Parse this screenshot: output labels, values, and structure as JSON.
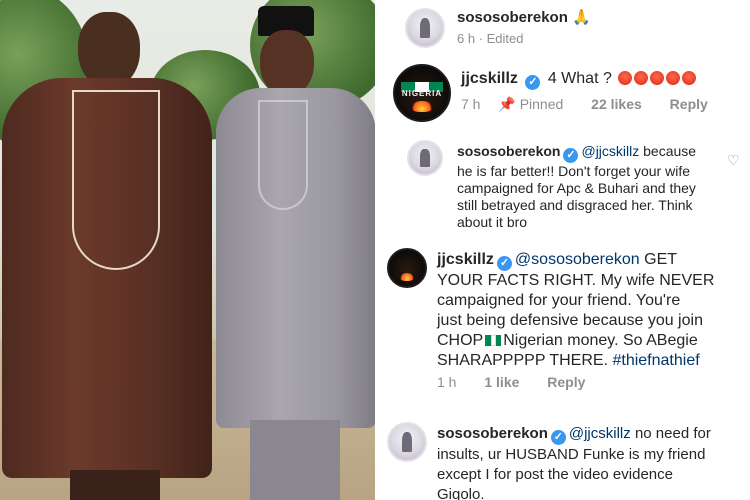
{
  "comments": [
    {
      "username": "sososoberekon",
      "text_suffix": "🙏",
      "time": "6 h",
      "edited": "Edited"
    },
    {
      "username": "jjcskillz",
      "text": "4 What ?",
      "emoji_count": 5,
      "time": "7 h",
      "pinned": "Pinned",
      "likes": "22 likes",
      "reply": "Reply",
      "avatar_text": "NIGERIA"
    },
    {
      "username": "sososoberekon",
      "mention": "@jjcskillz",
      "line1_rest": "because",
      "line2": "he is far better!! Don't forget your wife",
      "line3": "campaigned for Apc & Buhari and they",
      "line4": "still betrayed and disgraced her. Think",
      "line5": "about it bro"
    },
    {
      "username": "jjcskillz",
      "mention": "@sososoberekon",
      "line1_rest": "GET",
      "line2": "YOUR FACTS RIGHT. My wife NEVER",
      "line3": "campaigned for your friend. You're",
      "line4": "just being defensive because you join",
      "line5a": "CHOP",
      "line5b": "Nigerian money. So ABegie",
      "line6": "SHARAPPPPP THERE.",
      "hashtag": "#thiefnathief",
      "time": "1 h",
      "likes": "1 like",
      "reply": "Reply"
    },
    {
      "username": "sososoberekon",
      "mention": "@jjcskillz",
      "line1_rest": "no need for",
      "line2": "insults, ur HUSBAND Funke is my friend",
      "line3": "except I for post the video evidence",
      "line4": "Gigolo."
    }
  ],
  "colors": {
    "mention": "#00376b",
    "verified": "#3897f0",
    "meta": "#8e8e8e",
    "flag_green": "#008751"
  },
  "icons": [
    "verified-badge-icon",
    "pin-icon",
    "heart-icon",
    "pray-emoji-icon",
    "angry-emoji-icon",
    "nigeria-flag-icon"
  ]
}
